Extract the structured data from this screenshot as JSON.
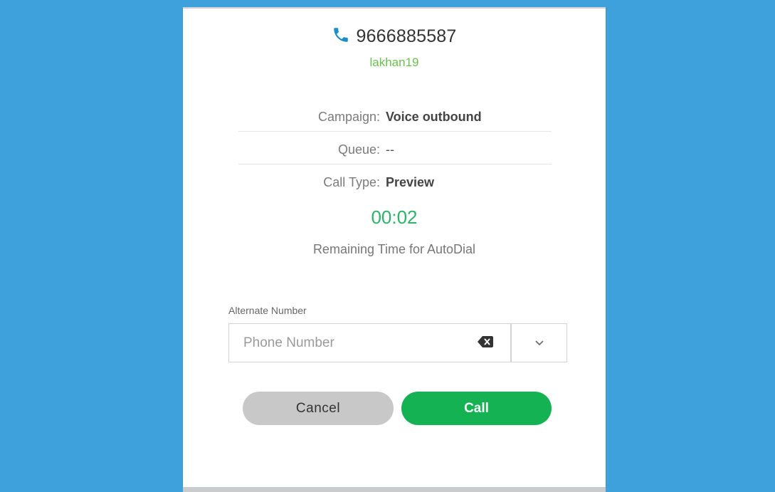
{
  "contact": {
    "phone_number": "9666885587",
    "username": "lakhan19"
  },
  "details": [
    {
      "label": "Campaign:",
      "value": "Voice outbound"
    },
    {
      "label": "Queue:",
      "value": "--"
    },
    {
      "label": "Call Type:",
      "value": "Preview"
    }
  ],
  "autodial": {
    "timer": "00:02",
    "label": "Remaining Time for AutoDial"
  },
  "alternate": {
    "label": "Alternate Number",
    "placeholder": "Phone Number",
    "value": ""
  },
  "actions": {
    "cancel_label": "Cancel",
    "call_label": "Call"
  },
  "icons": {
    "phone": "phone-icon",
    "clear": "backspace-icon",
    "dropdown": "chevron-down-icon"
  },
  "colors": {
    "background": "#3fa1db",
    "accent_green": "#14b252",
    "username_green": "#6bbf4e",
    "timer_green": "#2db36a",
    "phone_icon": "#1a8fc4"
  }
}
